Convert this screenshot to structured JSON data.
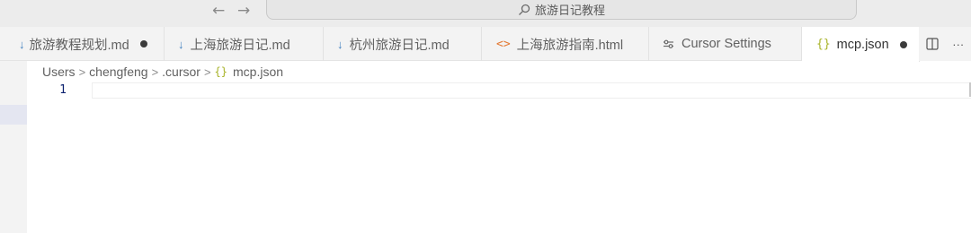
{
  "search": {
    "text": "旅游日记教程"
  },
  "nav": {
    "back": "←",
    "forward": "→"
  },
  "tabs": [
    {
      "label": "旅游教程规划.md",
      "icon": "markdown-icon",
      "dirty": true
    },
    {
      "label": "上海旅游日记.md",
      "icon": "markdown-icon",
      "dirty": false
    },
    {
      "label": "杭州旅游日记.md",
      "icon": "markdown-icon",
      "dirty": false
    },
    {
      "label": "上海旅游指南.html",
      "icon": "html-icon",
      "dirty": false
    },
    {
      "label": "Cursor Settings",
      "icon": "settings-icon",
      "dirty": false
    },
    {
      "label": "mcp.json",
      "icon": "json-icon",
      "dirty": true,
      "active": true
    }
  ],
  "icons": {
    "html": "<>",
    "json": "{}",
    "md": "↓"
  },
  "tab_actions": {
    "more": "···"
  },
  "breadcrumb": [
    "Users",
    "chengfeng",
    ".cursor",
    "mcp.json"
  ],
  "editor": {
    "line_numbers": [
      "1"
    ],
    "content": ""
  },
  "colors": {
    "tabbar": "#f3f3f3",
    "active_tab": "#ffffff",
    "json_icon": "#a8b329",
    "html_icon": "#e37933",
    "md_icon": "#3f7fbf"
  }
}
